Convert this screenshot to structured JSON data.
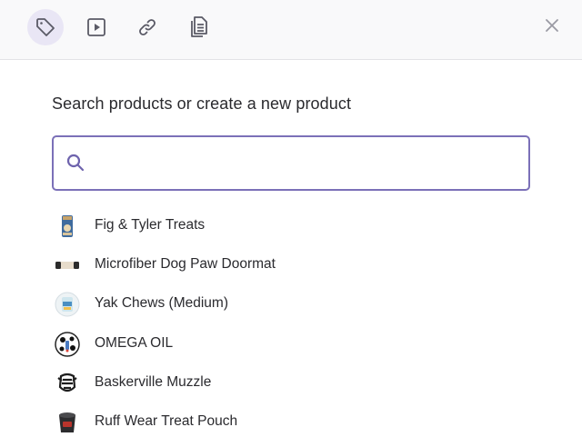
{
  "toolbar": {
    "tools": [
      {
        "icon": "tag-icon",
        "active": true
      },
      {
        "icon": "play-video-icon",
        "active": false
      },
      {
        "icon": "link-icon",
        "active": false
      },
      {
        "icon": "document-icon",
        "active": false
      }
    ],
    "close_icon": "close-icon"
  },
  "colors": {
    "accent": "#7b70b8",
    "active_tool_bg": "#e9e6f5",
    "icon": "#5a5a66",
    "text": "#2a2a2e"
  },
  "search": {
    "prompt": "Search products or create a new product",
    "value": "",
    "placeholder": ""
  },
  "results": [
    {
      "label": "Fig & Tyler Treats",
      "thumb": "treat-bag-thumbnail"
    },
    {
      "label": "Microfiber Dog Paw Doormat",
      "thumb": "doormat-thumbnail"
    },
    {
      "label": "Yak Chews (Medium)",
      "thumb": "yak-chews-thumbnail"
    },
    {
      "label": "OMEGA OIL",
      "thumb": "omega-oil-thumbnail"
    },
    {
      "label": "Baskerville Muzzle",
      "thumb": "muzzle-thumbnail"
    },
    {
      "label": "Ruff Wear Treat Pouch",
      "thumb": "treat-pouch-thumbnail"
    }
  ]
}
